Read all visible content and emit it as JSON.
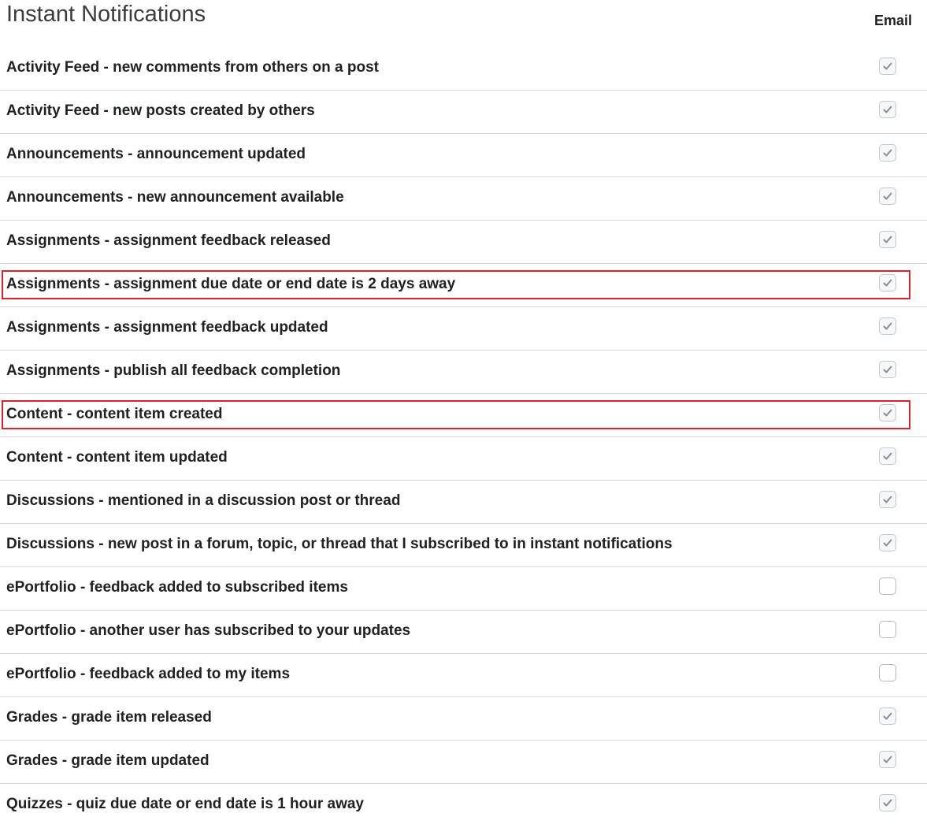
{
  "page": {
    "title": "Instant Notifications",
    "column_header": "Email"
  },
  "rows": [
    {
      "label": "Activity Feed - new comments from others on a post",
      "checked": true,
      "highlighted": false
    },
    {
      "label": "Activity Feed - new posts created by others",
      "checked": true,
      "highlighted": false
    },
    {
      "label": "Announcements - announcement updated",
      "checked": true,
      "highlighted": false
    },
    {
      "label": "Announcements - new announcement available",
      "checked": true,
      "highlighted": false
    },
    {
      "label": "Assignments - assignment feedback released",
      "checked": true,
      "highlighted": false
    },
    {
      "label": "Assignments - assignment due date or end date is 2 days away",
      "checked": true,
      "highlighted": true
    },
    {
      "label": "Assignments - assignment feedback updated",
      "checked": true,
      "highlighted": false
    },
    {
      "label": "Assignments - publish all feedback completion",
      "checked": true,
      "highlighted": false
    },
    {
      "label": "Content - content item created",
      "checked": true,
      "highlighted": true
    },
    {
      "label": "Content - content item updated",
      "checked": true,
      "highlighted": false
    },
    {
      "label": "Discussions - mentioned in a discussion post or thread",
      "checked": true,
      "highlighted": false
    },
    {
      "label": "Discussions - new post in a forum, topic, or thread that I subscribed to in instant notifications",
      "checked": true,
      "highlighted": false
    },
    {
      "label": "ePortfolio - feedback added to subscribed items",
      "checked": false,
      "highlighted": false
    },
    {
      "label": "ePortfolio - another user has subscribed to your updates",
      "checked": false,
      "highlighted": false
    },
    {
      "label": "ePortfolio - feedback added to my items",
      "checked": false,
      "highlighted": false
    },
    {
      "label": "Grades - grade item released",
      "checked": true,
      "highlighted": false
    },
    {
      "label": "Grades - grade item updated",
      "checked": true,
      "highlighted": false
    },
    {
      "label": "Quizzes - quiz due date or end date is 1 hour away",
      "checked": true,
      "highlighted": false
    }
  ],
  "colors": {
    "highlight_border": "#d9232d",
    "check_mark": "#8a8c8f"
  },
  "icons": {
    "checkbox": "checkbox-icon",
    "check": "check-icon"
  }
}
